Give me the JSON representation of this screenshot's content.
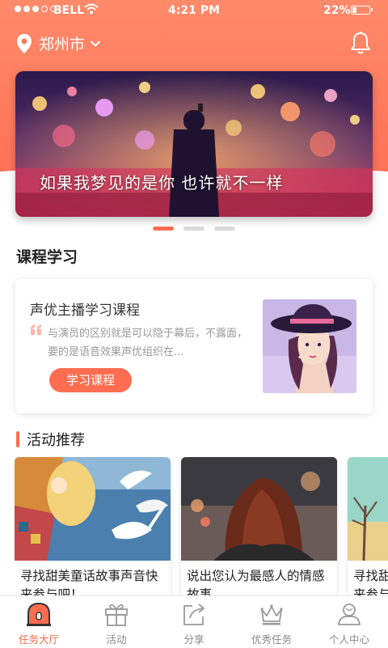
{
  "status_bar": {
    "carrier": "BELL",
    "time": "4:21 PM",
    "battery": "22%"
  },
  "header": {
    "location": "郑州市"
  },
  "banner": {
    "caption": "如果我梦见的是你  也许就不一样",
    "active_page": 1,
    "pages": 3
  },
  "course_section": {
    "title": "课程学习",
    "course": {
      "name": "声优主播学习课程",
      "description": "与演员的区别就是可以隐于幕后，不露面，要的是语音效果声优组织在...",
      "button": "学习课程"
    }
  },
  "activity_section": {
    "title": "活动推荐",
    "cards": [
      {
        "title": "寻找甜美童话故事声音快来参与吧！"
      },
      {
        "title": "说出您认为最感人的情感故事"
      },
      {
        "title": "寻找甜美童话故事声音快来参与吧！"
      }
    ]
  },
  "tabbar": {
    "tabs": [
      {
        "label": "任务大厅",
        "icon": "task-hall-icon",
        "active": true
      },
      {
        "label": "活动",
        "icon": "gift-icon"
      },
      {
        "label": "分享",
        "icon": "share-icon"
      },
      {
        "label": "优秀任务",
        "icon": "crown-icon"
      },
      {
        "label": "个人中心",
        "icon": "user-icon"
      }
    ]
  },
  "colors": {
    "accent": "#ff6d50",
    "header": "#ff7a5c"
  }
}
